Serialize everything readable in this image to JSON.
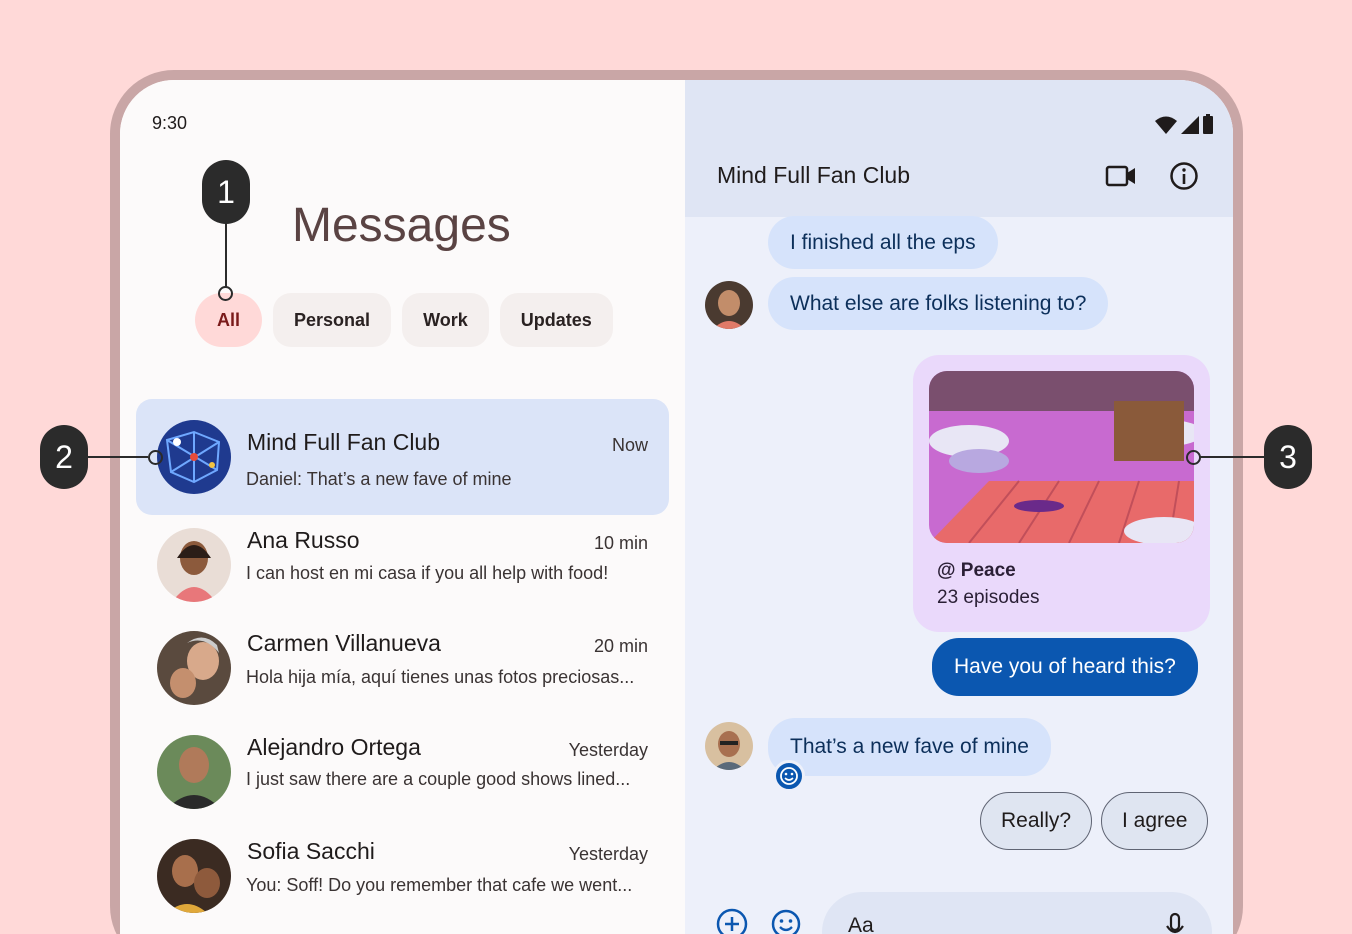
{
  "status_bar": {
    "time": "9:30"
  },
  "list_pane": {
    "title": "Messages",
    "filters": [
      {
        "label": "All",
        "active": true
      },
      {
        "label": "Personal",
        "active": false
      },
      {
        "label": "Work",
        "active": false
      },
      {
        "label": "Updates",
        "active": false
      }
    ],
    "conversations": [
      {
        "name": "Mind Full Fan Club",
        "time": "Now",
        "preview": "Daniel: That’s a new fave of mine",
        "selected": true
      },
      {
        "name": "Ana Russo",
        "time": "10 min",
        "preview": "I can host en mi casa if you all help with food!",
        "selected": false
      },
      {
        "name": "Carmen Villanueva",
        "time": "20 min",
        "preview": "Hola hija mía, aquí tienes unas fotos preciosas...",
        "selected": false
      },
      {
        "name": "Alejandro Ortega",
        "time": "Yesterday",
        "preview": "I just saw there are a couple good shows lined...",
        "selected": false
      },
      {
        "name": "Sofia Sacchi",
        "time": "Yesterday",
        "preview": "You: Soff! Do you remember that cafe we went...",
        "selected": false
      }
    ]
  },
  "chat_pane": {
    "title": "Mind Full Fan Club",
    "messages": {
      "m1": "I finished all the eps",
      "m2": "What else are folks listening to?",
      "card_title": "@ Peace",
      "card_subtitle": "23 episodes",
      "sent": "Have you of heard this?",
      "m3": "That’s a new fave of mine"
    },
    "suggested_replies": [
      "Really?",
      "I agree"
    ],
    "composer_placeholder": "Aa"
  },
  "callouts": [
    "1",
    "2",
    "3"
  ],
  "colors": {
    "background": "#ffd9d8",
    "selected_row": "#dbe4f8",
    "sent_bubble": "#0b57b0",
    "received_bubble": "#d6e3fb",
    "card": "#ead9fb"
  }
}
